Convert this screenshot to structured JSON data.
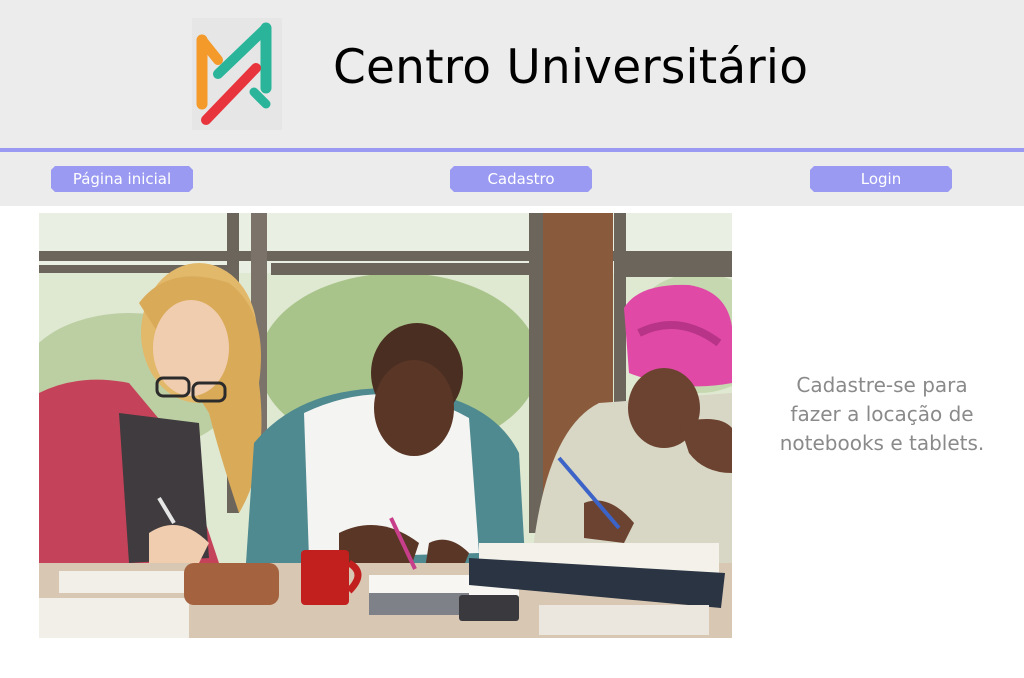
{
  "header": {
    "title": "Centro Universitário",
    "logo_icon": "university-logo",
    "logo_colors": [
      "#f39a2b",
      "#2ab59a",
      "#e8343c"
    ]
  },
  "nav": {
    "items": [
      {
        "label": "Página inicial"
      },
      {
        "label": "Cadastro"
      },
      {
        "label": "Login"
      }
    ],
    "button_color": "#9a9af2",
    "divider_color": "#9a9af2"
  },
  "hero": {
    "image_subject": "students-studying-photo"
  },
  "promo": {
    "text": "Cadastre-se para fazer a locação de notebooks e tablets."
  }
}
